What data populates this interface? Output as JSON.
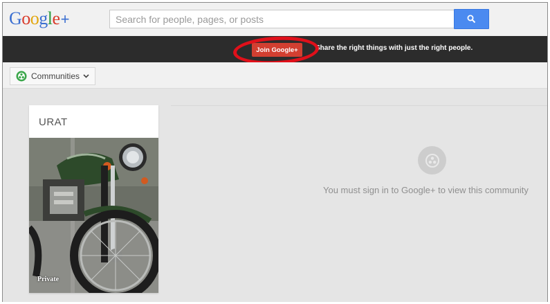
{
  "header": {
    "logo_letters": [
      {
        "ch": "G",
        "color": "#3b6fd1"
      },
      {
        "ch": "o",
        "color": "#d93b2b"
      },
      {
        "ch": "o",
        "color": "#e2a70f"
      },
      {
        "ch": "g",
        "color": "#3b6fd1"
      },
      {
        "ch": "l",
        "color": "#2a9a3e"
      },
      {
        "ch": "e",
        "color": "#d93b2b"
      }
    ],
    "logo_plus": "+",
    "search_placeholder": "Search for people, pages, or posts",
    "search_icon": "search-icon"
  },
  "banner": {
    "join_label": "Join Google+",
    "tagline": "Share the right things with just the right people.",
    "annotation_color": "#e0101a"
  },
  "subbar": {
    "communities_label": "Communities",
    "communities_icon": "communities-icon",
    "chevron_icon": "chevron-down-icon"
  },
  "community": {
    "name": "URAT",
    "privacy": "Private",
    "image": "motorcycle-photo"
  },
  "main": {
    "message": "You must sign in to Google+ to view this community",
    "icon": "communities-gray-icon"
  },
  "colors": {
    "accent_blue": "#4b8af0",
    "join_red": "#d23f31",
    "banner_dark": "#2c2c2c",
    "page_bg": "#e5e5e5"
  }
}
